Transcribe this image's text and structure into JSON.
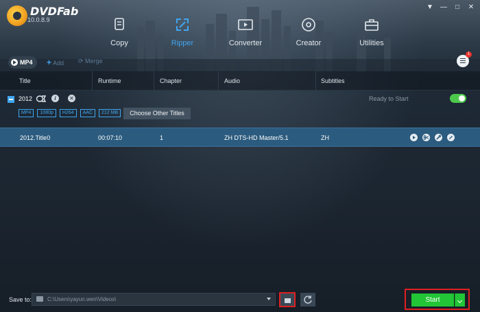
{
  "app": {
    "logo_text": "DVDFab",
    "version": "10.0.8.9"
  },
  "window_controls": [
    "▼",
    "—",
    "□",
    "✕"
  ],
  "modules": [
    {
      "label": "Copy",
      "icon": "copy-icon"
    },
    {
      "label": "Ripper",
      "icon": "ripper-icon",
      "active": true
    },
    {
      "label": "Converter",
      "icon": "converter-icon"
    },
    {
      "label": "Creator",
      "icon": "creator-icon"
    },
    {
      "label": "Utilities",
      "icon": "utilities-icon"
    }
  ],
  "subbar": {
    "format_label": "MP4",
    "add_label": "Add",
    "merge_label": "Merge",
    "menu_badge": "1"
  },
  "table": {
    "headers": [
      "Title",
      "Runtime",
      "Chapter",
      "Audio",
      "Subtitles"
    ]
  },
  "disc": {
    "title": "2012",
    "status": "Ready to Start",
    "tags": [
      "MP4",
      "1080p",
      "H264",
      "AAC",
      "212 MB"
    ],
    "choose_label": "Choose Other Titles"
  },
  "track": {
    "title": "2012.Title0",
    "runtime": "00:07:10",
    "chapter": "1",
    "audio": "ZH  DTS-HD Master/5.1",
    "subtitles": "ZH"
  },
  "bottom": {
    "save_to_label": "Save to:",
    "path": "C:\\Users\\yayun.wen\\Videos\\",
    "start_label": "Start"
  },
  "colors": {
    "accent": "#3ea6f0",
    "start_green": "#22c535",
    "highlight_red": "#e02020",
    "selected_row": "#2b5b7e"
  }
}
